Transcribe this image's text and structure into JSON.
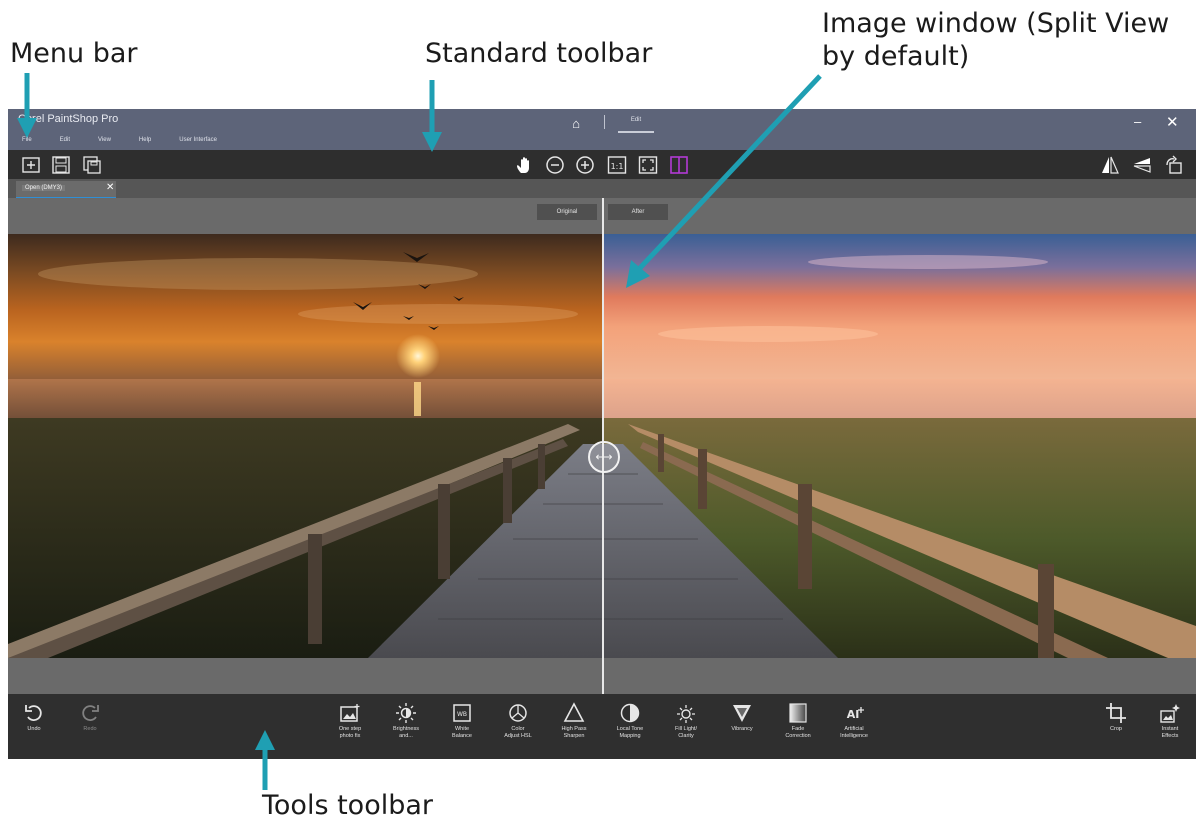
{
  "callouts": {
    "menu_bar": "Menu bar",
    "standard_toolbar": "Standard toolbar",
    "image_window_line1": "Image window (Split View",
    "image_window_line2": "by default)",
    "tools_toolbar": "Tools toolbar"
  },
  "app": {
    "title": "Corel PaintShop Pro",
    "menu": [
      "File",
      "Edit",
      "View",
      "Help",
      "User Interface"
    ],
    "mode_tab": "Edit",
    "accent": "#2f8fd6",
    "titlebar_color": "#5d6479"
  },
  "standard_toolbar": {
    "left_icons": [
      "open-file-icon",
      "save-icon",
      "save-as-icon"
    ],
    "center_icons": [
      "pan-hand-icon",
      "zoom-out-icon",
      "zoom-in-icon",
      "actual-size-icon",
      "fit-window-icon",
      "split-view-icon"
    ],
    "right_icons": [
      "flip-icon",
      "mirror-icon",
      "rotate-icon"
    ]
  },
  "document": {
    "tab_name": "Open (DMY3)"
  },
  "image_window": {
    "before_label": "Original",
    "after_label": "After"
  },
  "tools_toolbar": {
    "undo": "Undo",
    "redo": "Redo",
    "items": [
      {
        "label": "One step\nphoto fix",
        "icon": "photo-fix-icon"
      },
      {
        "label": "Brightness\nand...",
        "icon": "brightness-icon"
      },
      {
        "label": "White\nBalance",
        "icon": "white-balance-icon"
      },
      {
        "label": "Color\nAdjust HSL",
        "icon": "color-hsl-icon"
      },
      {
        "label": "High Pass\nSharpen",
        "icon": "sharpen-icon"
      },
      {
        "label": "Local Tone\nMapping",
        "icon": "tone-mapping-icon"
      },
      {
        "label": "Fill Light/\nClarity",
        "icon": "fill-light-icon"
      },
      {
        "label": "Vibrancy",
        "icon": "vibrancy-icon"
      },
      {
        "label": "Fade\nCorrection",
        "icon": "fade-correction-icon"
      },
      {
        "label": "Artificial\nIntelligence",
        "icon": "ai-icon"
      }
    ],
    "crop": "Crop",
    "instant_effects": "Instant\nEffects"
  }
}
